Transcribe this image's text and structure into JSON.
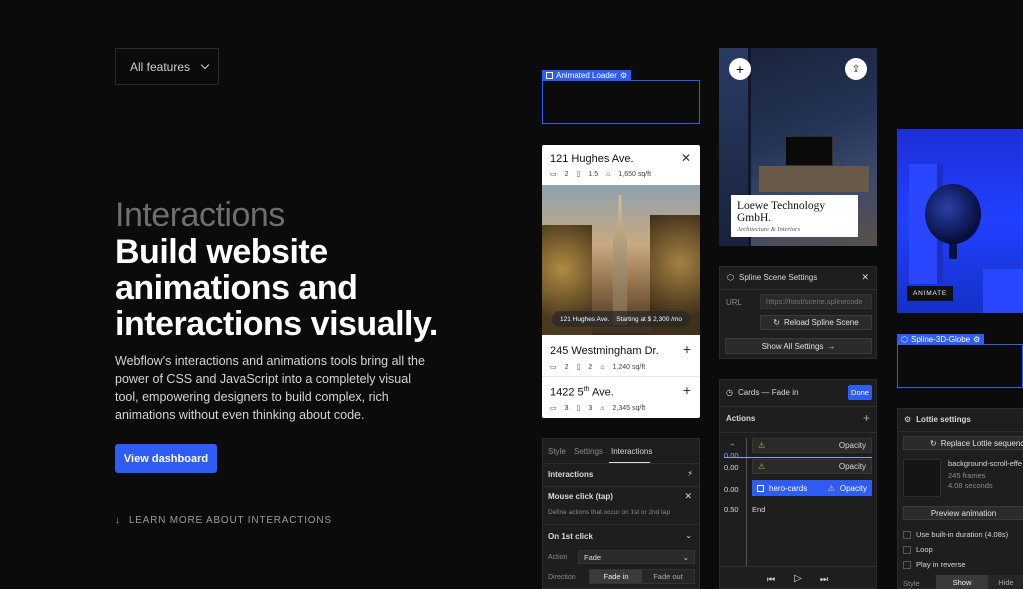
{
  "features_dropdown": {
    "label": "All features"
  },
  "hero": {
    "eyebrow": "Interactions",
    "headline_lines": [
      "Build website",
      "animations and",
      "interactions visually."
    ],
    "description": "Webflow's interactions and animations tools bring all the power of CSS and JavaScript into a completely visual tool, empowering designers to build complex, rich animations without even thinking about code.",
    "cta": "View dashboard",
    "learn_more": "LEARN MORE ABOUT INTERACTIONS"
  },
  "animated_loader": {
    "tag": "Animated Loader"
  },
  "listing": {
    "title": "121 Hughes Ave.",
    "beds": "2",
    "baths": "1.5",
    "sqft": "1,650 sq/ft",
    "photo_left": "121 Hughes Ave.",
    "photo_right": "Starting at $ 2,300 /mo",
    "items": [
      {
        "title": "245 Westmingham Dr.",
        "beds": "2",
        "baths": "2",
        "sqft": "1,240 sq/ft"
      },
      {
        "title_main": "1422 5",
        "title_sup": "th",
        "title_end": " Ave.",
        "beds": "3",
        "baths": "3",
        "sqft": "2,345 sq/ft"
      }
    ]
  },
  "room": {
    "brand": "Loewe Technology GmbH.",
    "subtitle": "Architecture & Interiors"
  },
  "blue_scene": {
    "button": "ANIMATE",
    "tag": "Spline-3D-Globe"
  },
  "spline": {
    "title": "Spline Scene Settings",
    "url_label": "URL",
    "url_placeholder": "https://host/scene.splinecode",
    "reload": "Reload Spline Scene",
    "show_all": "Show All Settings"
  },
  "interactions_panel": {
    "tabs": [
      "Style",
      "Settings",
      "Interactions"
    ],
    "section": "Interactions",
    "trigger": "Mouse click (tap)",
    "trigger_desc": "Define actions that occur on 1st or 2nd tap",
    "on_first": "On 1st click",
    "action_label": "Action",
    "action_value": "Fade",
    "direction_label": "Direction",
    "fade_in": "Fade in",
    "fade_out": "Fade out"
  },
  "timeline": {
    "title": "Cards — Fade in",
    "done": "Done",
    "actions": "Actions",
    "rows": [
      {
        "time": "0.00",
        "label": "Opacity"
      },
      {
        "time": "0.00",
        "label": "Opacity"
      },
      {
        "time": "0.00",
        "target": "hero-cards",
        "label": "Opacity"
      },
      {
        "time": "0.50",
        "label": "End"
      }
    ]
  },
  "lottie": {
    "title": "Lottie settings",
    "replace": "Replace Lottie sequence",
    "file": "background-scroll-effe",
    "frames": "245 frames",
    "duration": "4.08 seconds",
    "preview": "Preview animation",
    "opt1": "Use built-in duration (4.08s)",
    "opt2": "Loop",
    "opt3": "Play in reverse",
    "style_label": "Style",
    "show": "Show",
    "hide": "Hide"
  }
}
